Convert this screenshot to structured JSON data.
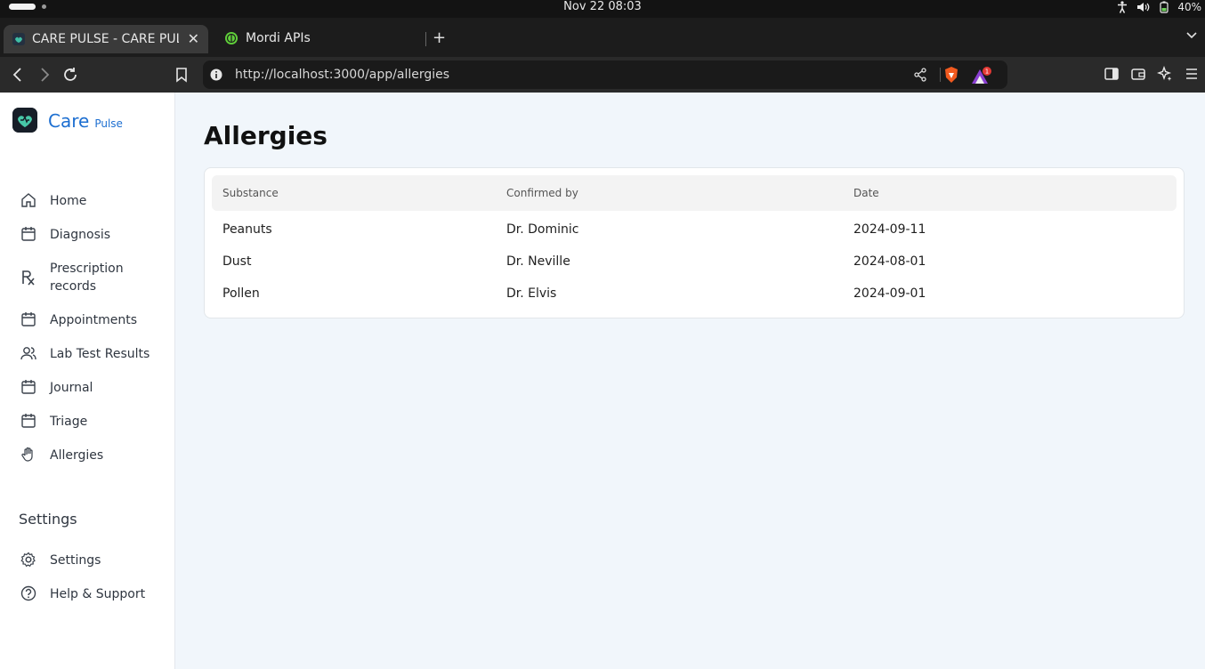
{
  "os": {
    "clock": "Nov 22  08:03",
    "battery": "40%"
  },
  "browser": {
    "tabs": [
      {
        "title": "CARE PULSE - CARE PULSE"
      },
      {
        "title": "Mordi APIs"
      }
    ],
    "url": "http://localhost:3000/app/allergies",
    "rewards_badge": "1"
  },
  "app": {
    "brand_name": "Care",
    "brand_sub": "Pulse",
    "nav": [
      {
        "label": "Home",
        "icon": "home-icon"
      },
      {
        "label": "Diagnosis",
        "icon": "calendar-icon"
      },
      {
        "label": "Prescription records",
        "icon": "rx-icon"
      },
      {
        "label": "Appointments",
        "icon": "calendar-icon"
      },
      {
        "label": "Lab Test Results",
        "icon": "users-icon"
      },
      {
        "label": "Journal",
        "icon": "calendar-icon"
      },
      {
        "label": "Triage",
        "icon": "calendar-icon"
      },
      {
        "label": "Allergies",
        "icon": "hand-icon"
      }
    ],
    "settings_heading": "Settings",
    "settings_nav": [
      {
        "label": "Settings",
        "icon": "gear-icon"
      },
      {
        "label": "Help & Support",
        "icon": "help-icon"
      }
    ]
  },
  "main": {
    "title": "Allergies",
    "table": {
      "columns": [
        "Substance",
        "Confirmed by",
        "Date"
      ],
      "rows": [
        [
          "Peanuts",
          "Dr. Dominic",
          "2024-09-11"
        ],
        [
          "Dust",
          "Dr. Neville",
          "2024-08-01"
        ],
        [
          "Pollen",
          "Dr. Elvis",
          "2024-09-01"
        ]
      ]
    }
  },
  "colors": {
    "brand": "#1d6fd1",
    "page_bg": "#f1f6fb"
  }
}
